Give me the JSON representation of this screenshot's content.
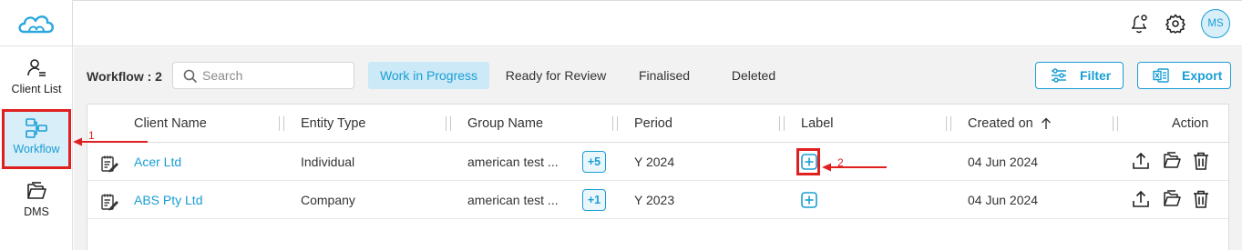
{
  "header": {
    "avatar_initials": "MS",
    "icons": [
      "bell-settings-icon",
      "gear-icon"
    ]
  },
  "sidebar": {
    "items": [
      {
        "label": "Client List",
        "icon": "client-list-icon"
      },
      {
        "label": "Workflow",
        "icon": "workflow-icon",
        "active": true
      },
      {
        "label": "DMS",
        "icon": "folder-icon"
      }
    ]
  },
  "toolbar": {
    "workflow_count": "Workflow : 2",
    "search_placeholder": "Search",
    "tabs": [
      "Work in Progress",
      "Ready for Review",
      "Finalised",
      "Deleted"
    ],
    "active_tab": "Work in Progress",
    "filter_label": "Filter",
    "export_label": "Export"
  },
  "table": {
    "columns": [
      "Client Name",
      "Entity Type",
      "Group Name",
      "Period",
      "Label",
      "Created on",
      "Action"
    ],
    "sort_icon": "arrow-up-icon",
    "rows": [
      {
        "client": "Acer Ltd",
        "entity": "Individual",
        "group": "american test ...",
        "more": "+5",
        "period": "Y 2024",
        "created": "04 Jun 2024"
      },
      {
        "client": "ABS Pty Ltd",
        "entity": "Company",
        "group": "american test ...",
        "more": "+1",
        "period": "Y 2023",
        "created": "04 Jun 2024"
      }
    ]
  },
  "annotations": {
    "marker_1": "1",
    "marker_2": "2",
    "color": "#e02020"
  },
  "colors": {
    "accent": "#1a9ed4",
    "active_tab_bg": "#cbe9f7",
    "annotation": "#e02020"
  }
}
